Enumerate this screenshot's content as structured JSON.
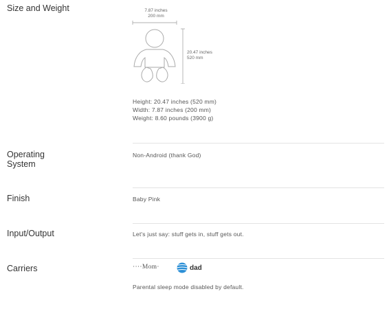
{
  "size_weight": {
    "title": "Size and Weight",
    "width_dim": [
      "7.87 inches",
      "200 mm"
    ],
    "height_dim": [
      "20.47 inches",
      "520 mm"
    ],
    "specs": [
      "Height: 20.47 inches (520 mm)",
      "Width: 7.87 inches (200 mm)",
      "Weight: 8.60 pounds (3900 g)"
    ]
  },
  "os": {
    "title_lines": [
      "Operating",
      "System"
    ],
    "value": "Non-Android (thank God)"
  },
  "finish": {
    "title": "Finish",
    "value": "Baby Pink"
  },
  "io": {
    "title": "Input/Output",
    "value": "Let's just say: stuff gets in, stuff gets out."
  },
  "carriers": {
    "title": "Carriers",
    "mom_logo": "····Mom·",
    "dad_logo": "dad",
    "icons": [
      "baby-outline-icon",
      "globe-icon"
    ],
    "note": "Parental sleep mode disabled by default."
  }
}
